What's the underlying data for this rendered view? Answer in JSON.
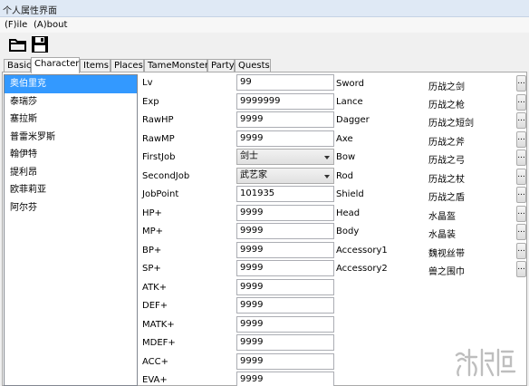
{
  "window": {
    "title": "个人属性界面"
  },
  "menu": [
    {
      "label": "(F)ile"
    },
    {
      "label": "(A)bout"
    }
  ],
  "toolbar": [
    {
      "icon": "folder-open-icon"
    },
    {
      "icon": "save-icon"
    }
  ],
  "tabs": [
    {
      "label": "Basic",
      "active": false
    },
    {
      "label": "Character",
      "active": true
    },
    {
      "label": "Items",
      "active": false
    },
    {
      "label": "Places",
      "active": false
    },
    {
      "label": "TameMonster",
      "active": false
    },
    {
      "label": "Party",
      "active": false
    },
    {
      "label": "Quests",
      "active": false
    }
  ],
  "characters": [
    {
      "name": "奥伯里克",
      "selected": true
    },
    {
      "name": "泰瑞莎",
      "selected": false
    },
    {
      "name": "塞拉斯",
      "selected": false
    },
    {
      "name": "普雷米罗斯",
      "selected": false
    },
    {
      "name": "翰伊特",
      "selected": false
    },
    {
      "name": "提利昂",
      "selected": false
    },
    {
      "name": "欧菲莉亚",
      "selected": false
    },
    {
      "name": "阿尔芬",
      "selected": false
    }
  ],
  "stats": [
    {
      "label": "Lv",
      "value": "99",
      "type": "text"
    },
    {
      "label": "Exp",
      "value": "9999999",
      "type": "text"
    },
    {
      "label": "RawHP",
      "value": "9999",
      "type": "text"
    },
    {
      "label": "RawMP",
      "value": "9999",
      "type": "text"
    },
    {
      "label": "FirstJob",
      "value": "剑士",
      "type": "select"
    },
    {
      "label": "SecondJob",
      "value": "武艺家",
      "type": "select"
    },
    {
      "label": "JobPoint",
      "value": "101935",
      "type": "text"
    },
    {
      "label": "HP+",
      "value": "9999",
      "type": "text"
    },
    {
      "label": "MP+",
      "value": "9999",
      "type": "text"
    },
    {
      "label": "BP+",
      "value": "9999",
      "type": "text"
    },
    {
      "label": "SP+",
      "value": "9999",
      "type": "text"
    },
    {
      "label": "ATK+",
      "value": "9999",
      "type": "text"
    },
    {
      "label": "DEF+",
      "value": "9999",
      "type": "text"
    },
    {
      "label": "MATK+",
      "value": "9999",
      "type": "text"
    },
    {
      "label": "MDEF+",
      "value": "9999",
      "type": "text"
    },
    {
      "label": "ACC+",
      "value": "9999",
      "type": "text"
    },
    {
      "label": "EVA+",
      "value": "9999",
      "type": "text"
    }
  ],
  "equipment": [
    {
      "slot": "Sword",
      "item": "历战之剑"
    },
    {
      "slot": "Lance",
      "item": "历战之枪"
    },
    {
      "slot": "Dagger",
      "item": "历战之短剑"
    },
    {
      "slot": "Axe",
      "item": "历战之斧"
    },
    {
      "slot": "Bow",
      "item": "历战之弓"
    },
    {
      "slot": "Rod",
      "item": "历战之杖"
    },
    {
      "slot": "Shield",
      "item": "历战之盾"
    },
    {
      "slot": "Head",
      "item": "水晶盔"
    },
    {
      "slot": "Body",
      "item": "水晶装"
    },
    {
      "slot": "Accessory1",
      "item": "魏视丝带"
    },
    {
      "slot": "Accessory2",
      "item": "兽之围巾"
    }
  ],
  "equip_button_label": "...",
  "watermark": {
    "text": "游侠网"
  }
}
